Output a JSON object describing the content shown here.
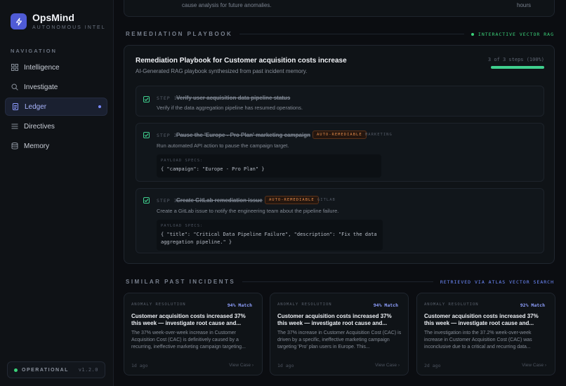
{
  "brand": {
    "name": "OpsMind",
    "subtitle": "AUTONOMOUS INTEL",
    "logo_icon": "lightning-icon",
    "accent": "#4f5bd5"
  },
  "nav": {
    "title": "NAVIGATION",
    "items": [
      {
        "label": "Intelligence",
        "icon": "grid-icon",
        "active": false
      },
      {
        "label": "Investigate",
        "icon": "search-icon",
        "active": false
      },
      {
        "label": "Ledger",
        "icon": "document-icon",
        "active": true
      },
      {
        "label": "Directives",
        "icon": "list-icon",
        "active": false
      },
      {
        "label": "Memory",
        "icon": "database-icon",
        "active": false
      }
    ]
  },
  "status": {
    "label": "OPERATIONAL",
    "version": "v1.2.0",
    "color": "#3bd37a"
  },
  "top_card": {
    "text": "cause analysis for future anomalies.",
    "right_text": "hours"
  },
  "remediation": {
    "section_title": "REMEDIATION PLAYBOOK",
    "section_tag": "INTERACTIVE VECTOR RAG",
    "title": "Remediation Playbook for Customer acquisition costs increase",
    "subtitle": "AI-Generated RAG playbook synthesized from past incident memory.",
    "progress_text": "3 of 3 steps (100%)",
    "progress": 1.0,
    "steps": [
      {
        "num": "STEP 1",
        "name": "Verify user acquisition data pipeline status",
        "desc": "Verify if the data aggregation pipeline has resumed operations.",
        "completed": true
      },
      {
        "num": "STEP 2",
        "name": "Pause the 'Europe - Pro Plan' marketing campaign",
        "badge": "AUTO-REMEDIABLE",
        "tool": "MARKETING",
        "desc": "Run automated API action to pause the campaign target.",
        "payload_label": "PAYLOAD SPECS:",
        "payload": "{ \"campaign\": \"Europe - Pro Plan\" }",
        "completed": true
      },
      {
        "num": "STEP 3",
        "name": "Create GitLab remediation issue",
        "badge": "AUTO-REMEDIABLE",
        "tool": "GITLAB",
        "desc": "Create a GitLab issue to notify the engineering team about the pipeline failure.",
        "payload_label": "PAYLOAD SPECS:",
        "payload": "{ \"title\": \"Critical Data Pipeline Failure\", \"description\": \"Fix the data\naggregation pipeline.\" }",
        "completed": true
      }
    ]
  },
  "similar": {
    "section_title": "SIMILAR PAST INCIDENTS",
    "section_tag": "RETRIEVED VIA ATLAS VECTOR SEARCH",
    "cards": [
      {
        "tag": "ANOMALY RESOLUTION",
        "match": "94% Match",
        "title": "Customer acquisition costs increased 37% this week — investigate root cause and...",
        "desc": "The 37% week-over-week increase in Customer Acquisition Cost (CAC) is definitively caused by a recurring, ineffective marketing campaign targeting...",
        "age": "1d ago",
        "view": "View Case"
      },
      {
        "tag": "ANOMALY RESOLUTION",
        "match": "94% Match",
        "title": "Customer acquisition costs increased 37% this week — investigate root cause and...",
        "desc": "The 37% increase in Customer Acquisition Cost (CAC) is driven by a specific, ineffective marketing campaign targeting 'Pro' plan users in Europe. This...",
        "age": "1d ago",
        "view": "View Case"
      },
      {
        "tag": "ANOMALY RESOLUTION",
        "match": "92% Match",
        "title": "Customer acquisition costs increased 37% this week — investigate root cause and...",
        "desc": "The investigation into the 37.2% week-over-week increase in Customer Acquisition Cost (CAC) was inconclusive due to a critical and recurring data...",
        "age": "2d ago",
        "view": "View Case"
      }
    ]
  }
}
